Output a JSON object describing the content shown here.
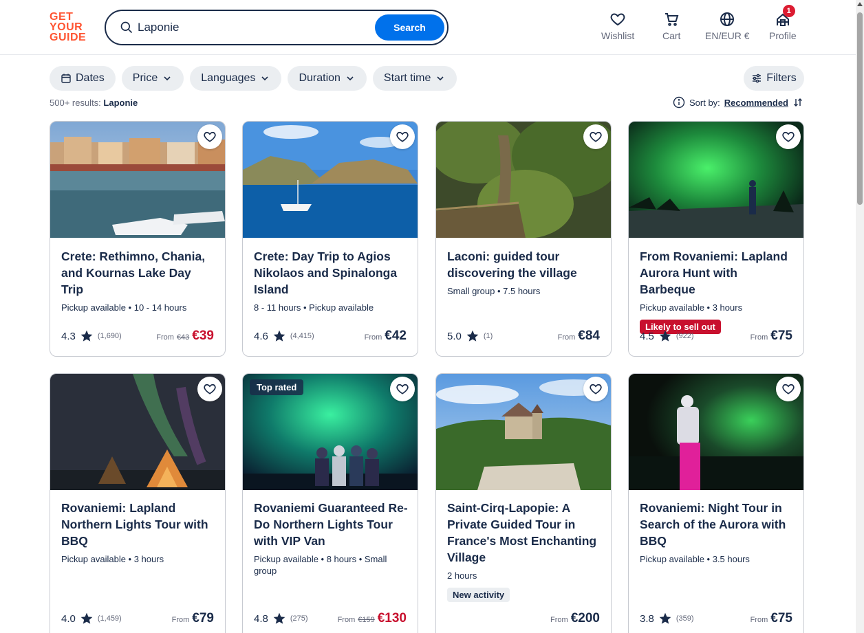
{
  "brand": {
    "line1": "GET",
    "line2": "YOUR",
    "line3": "GUIDE"
  },
  "search": {
    "value": "Laponie",
    "button": "Search"
  },
  "nav": {
    "wishlist": "Wishlist",
    "cart": "Cart",
    "language": "EN/EUR €",
    "profile": "Profile",
    "profile_badge": "1"
  },
  "filters": [
    "Dates",
    "Price",
    "Languages",
    "Duration",
    "Start time"
  ],
  "filters_button": "Filters",
  "results": {
    "prefix": "500+ results:",
    "query": "Laponie"
  },
  "sort": {
    "label": "Sort by:",
    "value": "Recommended"
  },
  "cards": [
    {
      "title": "Crete: Rethimno, Chania, and Kournas Lake Day Trip",
      "meta": "Pickup available • 10 - 14 hours",
      "rating": "4.3",
      "count": "(1,690)",
      "from": "From",
      "old_price": "€43",
      "price": "€39",
      "sale": true
    },
    {
      "title": "Crete: Day Trip to Agios Nikolaos and Spinalonga Island",
      "meta": "8 - 11 hours • Pickup available",
      "rating": "4.6",
      "count": "(4,415)",
      "from": "From",
      "old_price": "",
      "price": "€42",
      "sale": false
    },
    {
      "title": "Laconi: guided tour discovering the village",
      "meta": "Small group • 7.5 hours",
      "rating": "5.0",
      "count": "(1)",
      "from": "From",
      "old_price": "",
      "price": "€84",
      "sale": false
    },
    {
      "title": "From Rovaniemi: Lapland Aurora Hunt with Barbeque",
      "meta": "Pickup available • 3 hours",
      "tag": "Likely to sell out",
      "rating": "4.5",
      "count": "(922)",
      "from": "From",
      "old_price": "",
      "price": "€75",
      "sale": false
    },
    {
      "title": "Rovaniemi: Lapland Northern Lights Tour with BBQ",
      "meta": "Pickup available • 3 hours",
      "rating": "4.0",
      "count": "(1,459)",
      "from": "From",
      "old_price": "",
      "price": "€79",
      "sale": false
    },
    {
      "badge": "Top rated",
      "title": "Rovaniemi Guaranteed Re-Do Northern Lights Tour with VIP Van",
      "meta": "Pickup available • 8 hours • Small group",
      "rating": "4.8",
      "count": "(275)",
      "from": "From",
      "old_price": "€159",
      "price": "€130",
      "sale": true
    },
    {
      "title": "Saint-Cirq-Lapopie: A Private Guided Tour in France's Most Enchanting Village",
      "meta": "2 hours",
      "tag_new": "New activity",
      "rating": "",
      "count": "",
      "from": "From",
      "old_price": "",
      "price": "€200",
      "sale": false
    },
    {
      "title": "Rovaniemi: Night Tour in Search of the Aurora with BBQ",
      "meta": "Pickup available • 3.5 hours",
      "rating": "3.8",
      "count": "(359)",
      "from": "From",
      "old_price": "",
      "price": "€75",
      "sale": false
    }
  ],
  "colors": {
    "brand": "#ff5533",
    "primary": "#0071eb",
    "text": "#1a2b49",
    "sale": "#c8102e"
  }
}
